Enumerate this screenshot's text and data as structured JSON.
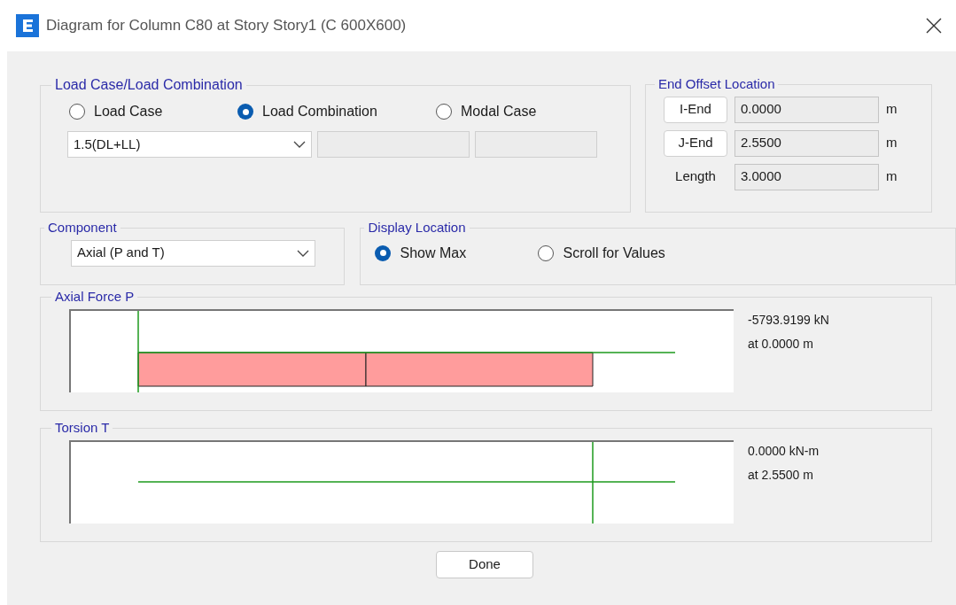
{
  "window": {
    "title": "Diagram for Column C80 at Story Story1 (C 600X600)"
  },
  "load_group": {
    "title": "Load Case/Load Combination",
    "options": [
      {
        "label": "Load Case",
        "selected": false
      },
      {
        "label": "Load Combination",
        "selected": true
      },
      {
        "label": "Modal Case",
        "selected": false
      }
    ],
    "combo": {
      "value": "1.5(DL+LL)"
    }
  },
  "end_offset": {
    "title": "End Offset Location",
    "rows": [
      {
        "kind": "button",
        "label": "I-End",
        "value": "0.0000",
        "unit": "m"
      },
      {
        "kind": "button",
        "label": "J-End",
        "value": "2.5500",
        "unit": "m"
      },
      {
        "kind": "text",
        "label": "Length",
        "value": "3.0000",
        "unit": "m"
      }
    ]
  },
  "component": {
    "title": "Component",
    "value": "Axial (P and T)"
  },
  "display_location": {
    "title": "Display Location",
    "options": [
      {
        "label": "Show Max",
        "selected": true
      },
      {
        "label": "Scroll for Values",
        "selected": false
      }
    ]
  },
  "diagrams": [
    {
      "kind": "axial",
      "title": "Axial Force P",
      "value": "-5793.9199 kN",
      "location": "at 0.0000 m"
    },
    {
      "kind": "torsion",
      "title": "Torsion T",
      "value": "0.0000 kN-m",
      "location": "at 2.5500 m"
    }
  ],
  "done_button": "Done"
}
